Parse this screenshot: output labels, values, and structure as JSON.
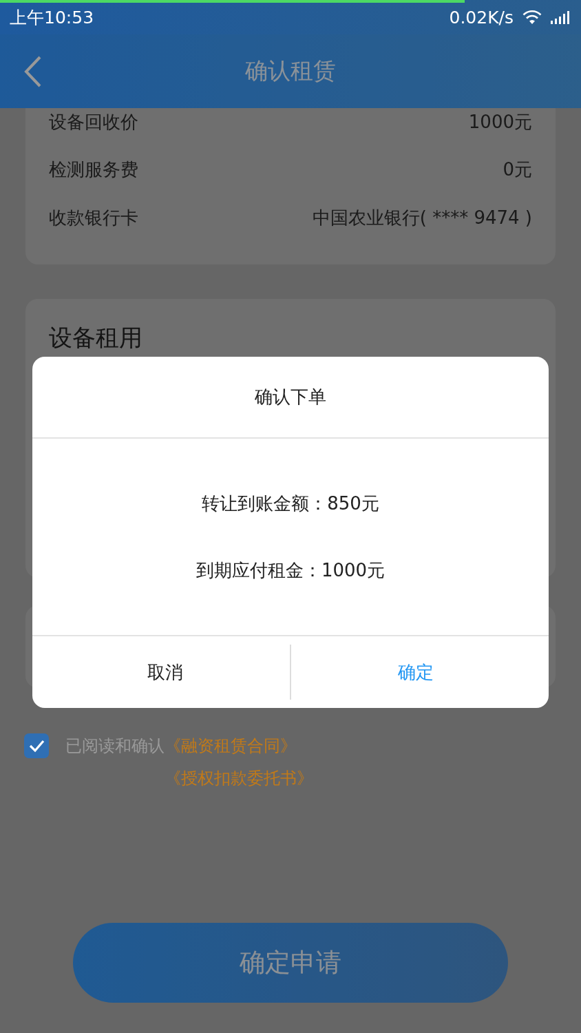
{
  "status_bar": {
    "time": "上午10:53",
    "net_speed": "0.02K/s"
  },
  "loading_bar": {
    "level": 0.8
  },
  "header": {
    "title": "确认租赁"
  },
  "summary_rows": [
    {
      "label": "设备回收价",
      "value": "1000元"
    },
    {
      "label": "检测服务费",
      "value": "0元"
    },
    {
      "label": "收款银行卡",
      "value": "中国农业银行( **** 9474 )"
    }
  ],
  "rental_card": {
    "title": "设备租用"
  },
  "agreement": {
    "checked": true,
    "text": "已阅读和确认",
    "links": [
      "《融资租赁合同》",
      "《授权扣款委托书》"
    ]
  },
  "submit_button": {
    "label": "确定申请"
  },
  "dialog": {
    "title": "确认下单",
    "lines": [
      "转让到账金额：850元",
      "到期应付租金：1000元"
    ],
    "buttons": [
      {
        "label": "取消",
        "kind": "cancel"
      },
      {
        "label": "确定",
        "kind": "confirm"
      }
    ]
  }
}
